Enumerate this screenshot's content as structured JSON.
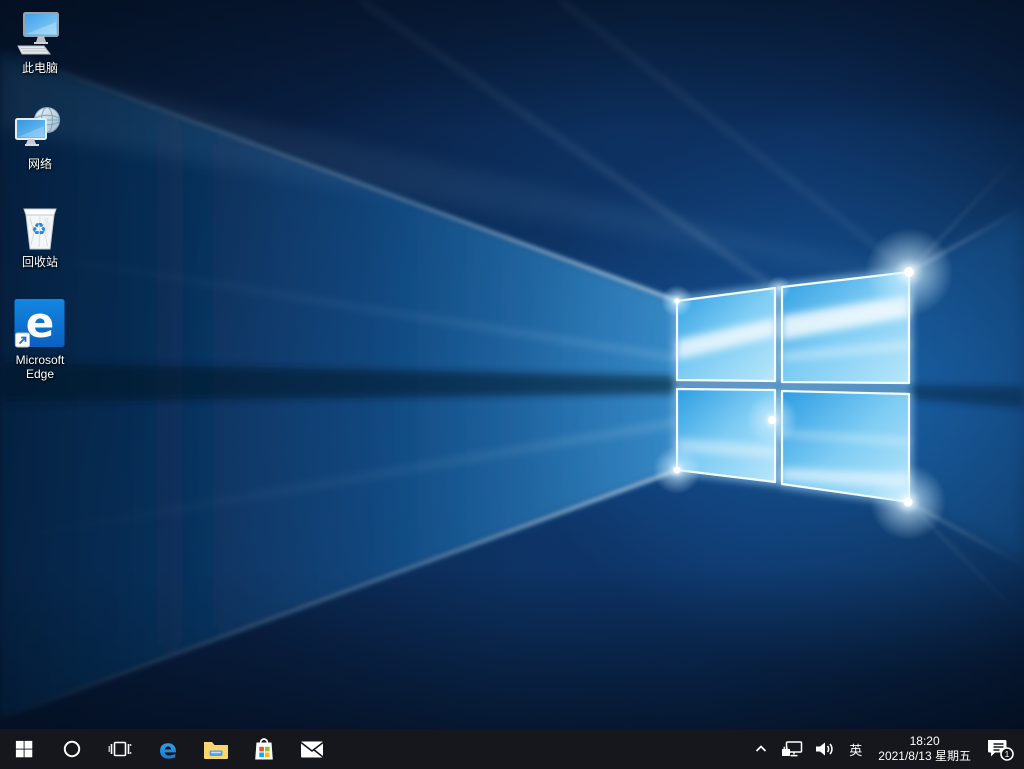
{
  "desktop": {
    "icons": [
      {
        "name": "this-pc",
        "label": "此电脑"
      },
      {
        "name": "network",
        "label": "网络"
      },
      {
        "name": "recycle-bin",
        "label": "回收站"
      },
      {
        "name": "microsoft-edge",
        "label": "Microsoft Edge"
      }
    ]
  },
  "taskbar": {
    "buttons": [
      {
        "name": "start",
        "icon": "windows-logo-icon"
      },
      {
        "name": "cortana-search",
        "icon": "circle-icon"
      },
      {
        "name": "task-view",
        "icon": "task-view-icon"
      },
      {
        "name": "edge",
        "icon": "edge-e-icon"
      },
      {
        "name": "file-explorer",
        "icon": "folder-icon"
      },
      {
        "name": "microsoft-store",
        "icon": "store-bag-icon"
      },
      {
        "name": "mail",
        "icon": "envelope-icon"
      }
    ],
    "tray": {
      "chevron": "chevron-up-icon",
      "network": "network-ethernet-icon",
      "volume": "speaker-icon",
      "ime_label": "英",
      "time": "18:20",
      "date": "2021/8/13 星期五",
      "notification_badge": "1"
    }
  },
  "colors": {
    "taskbar_bg": "#15171c",
    "wallpaper_deep": "#061630",
    "wallpaper_mid": "#0c2a54",
    "logo_pane_blue": "#2d9de2",
    "logo_pane_light": "#b8e6fa",
    "edge_tile_blue": "#1080dd",
    "folder_yellow": "#f9c64d",
    "store_red": "#f1511b",
    "store_green": "#80cc28",
    "store_blue": "#00adef",
    "store_yellow": "#fbbc09"
  }
}
